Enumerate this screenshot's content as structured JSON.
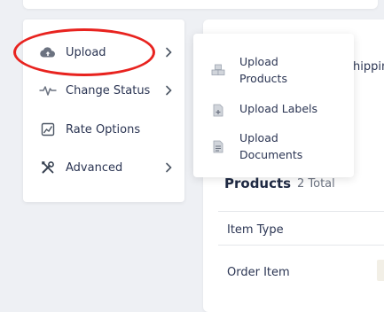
{
  "menu": {
    "items": [
      {
        "label": "Upload",
        "icon": "cloud-upload-icon",
        "has_submenu": true
      },
      {
        "label": "Change Status",
        "icon": "activity-icon",
        "has_submenu": true
      },
      {
        "label": "Rate Options",
        "icon": "chart-icon",
        "has_submenu": false
      },
      {
        "label": "Advanced",
        "icon": "tools-icon",
        "has_submenu": true
      }
    ]
  },
  "submenu": {
    "items": [
      {
        "label_line1": "Upload",
        "label_line2": "Products",
        "icon": "boxes-icon"
      },
      {
        "label_line1": "Upload Labels",
        "label_line2": "",
        "icon": "file-plus-icon"
      },
      {
        "label_line1": "Upload",
        "label_line2": "Documents",
        "icon": "file-text-icon"
      }
    ]
  },
  "main": {
    "shipping_fragment": "hippin",
    "products_title": "Products",
    "products_count": "2 Total",
    "column_header": "Item Type",
    "row_value": "Order Item"
  },
  "colors": {
    "highlight": "#e8231f",
    "text": "#2b3553",
    "background": "#eef0f4"
  }
}
